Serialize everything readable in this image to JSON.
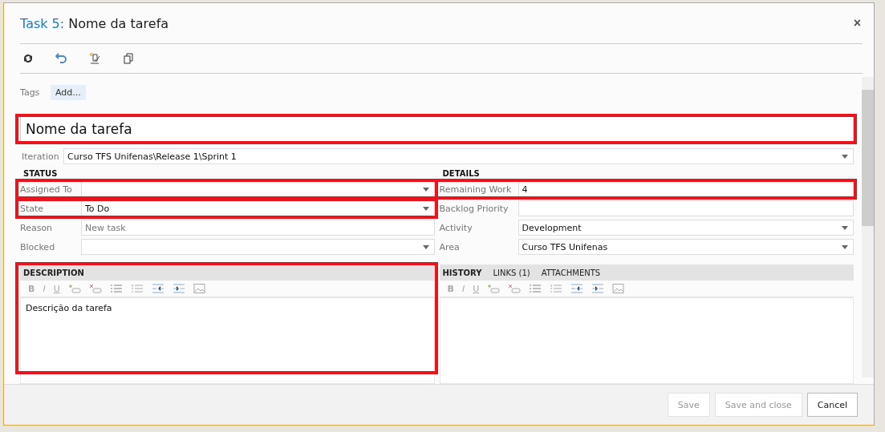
{
  "window": {
    "title_prefix": "Task 5:",
    "title": "Nome da tarefa",
    "close": "×"
  },
  "toolbar": [
    {
      "kind": "refresh"
    },
    {
      "kind": "undo"
    },
    {
      "kind": "rules"
    },
    {
      "kind": "copy"
    }
  ],
  "tags": {
    "label": "Tags",
    "button": "Add..."
  },
  "title_field": {
    "value": "Nome da tarefa",
    "highlighted": true
  },
  "iteration": {
    "label": "Iteration",
    "value": "Curso TFS Unifenas\\Release 1\\Sprint 1"
  },
  "status": {
    "heading": "STATUS",
    "fields": [
      {
        "label": "Assigned To",
        "kind": "dropdown",
        "highlighted": true
      },
      {
        "label": "State",
        "value": "To Do",
        "kind": "dropdown",
        "highlighted": true
      },
      {
        "label": "Reason",
        "value": "New task",
        "kind": "readonly",
        "highlighted": false
      },
      {
        "label": "Blocked",
        "kind": "dropdown",
        "highlighted": false
      }
    ]
  },
  "details": {
    "heading": "DETAILS",
    "fields": [
      {
        "label": "Remaining Work",
        "value": "4",
        "kind": "text",
        "highlighted": true
      },
      {
        "label": "Backlog Priority",
        "kind": "text",
        "highlighted": false
      },
      {
        "label": "Activity",
        "value": "Development",
        "kind": "dropdown",
        "highlighted": false
      },
      {
        "label": "Area",
        "value": "Curso TFS Unifenas",
        "kind": "dropdown",
        "highlighted": false
      }
    ]
  },
  "editors": [
    {
      "tabs": [
        {
          "label": "DESCRIPTION",
          "selected": true
        }
      ],
      "format": [
        "B",
        "I",
        "U"
      ],
      "text": "Descrição da tarefa",
      "highlighted": true
    },
    {
      "tabs": [
        {
          "label": "HISTORY",
          "selected": true
        },
        {
          "label": "LINKS (1)",
          "selected": false
        },
        {
          "label": "ATTACHMENTS",
          "selected": false
        }
      ],
      "format": [
        "B",
        "I",
        "U"
      ],
      "highlighted": false
    }
  ],
  "buttons": [
    {
      "label": "Save",
      "disabled": true
    },
    {
      "label": "Save and close",
      "disabled": true
    },
    {
      "label": "Cancel",
      "disabled": false
    }
  ]
}
